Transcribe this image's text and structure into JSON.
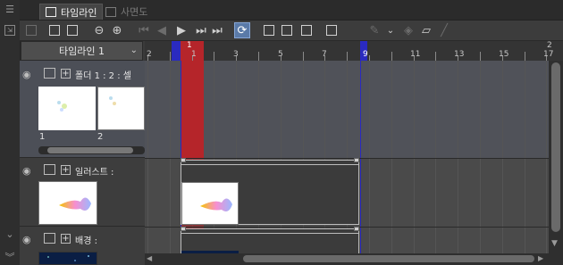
{
  "tabs": [
    {
      "label": "타임라인",
      "active": true
    },
    {
      "label": "사면도",
      "active": false
    }
  ],
  "timeline_select": {
    "value": "타임라인 1"
  },
  "ruler": {
    "numbers": [
      {
        "label": "2",
        "frame": 0
      },
      {
        "label": "1",
        "frame": 1
      },
      {
        "label": "3",
        "frame": 3
      },
      {
        "label": "5",
        "frame": 5
      },
      {
        "label": "7",
        "frame": 7
      },
      {
        "label": "9",
        "frame": 9
      },
      {
        "label": "11",
        "frame": 11
      },
      {
        "label": "13",
        "frame": 13
      },
      {
        "label": "15",
        "frame": 15
      },
      {
        "label": "2",
        "frame": 18
      },
      {
        "label": "17",
        "frame": 18
      }
    ],
    "current_frame_label": "1",
    "end_frame_label": "9"
  },
  "layers": [
    {
      "name": "폴더 1 : 2 : 셀",
      "type": "folder",
      "cells": [
        {
          "label": "1"
        },
        {
          "label": "2"
        }
      ]
    },
    {
      "name": "일러스트 :",
      "type": "image"
    },
    {
      "name": "배경 :",
      "type": "image"
    }
  ],
  "colors": {
    "playhead": "#b5252a",
    "range_marker": "#2a2ac0",
    "active_tool": "#5a7aa8"
  },
  "toolbar_icons": [
    "layer-icon",
    "new-folder-timeline-icon",
    "timeline-settings-icon",
    "zoom-out-icon",
    "zoom-in-icon",
    "first-frame-icon",
    "prev-frame-icon",
    "play-icon",
    "next-frame-icon",
    "last-frame-icon",
    "loop-icon",
    "new-cell-icon",
    "new-animation-cell-icon",
    "specify-cell-icon",
    "cell-copy-icon",
    "keyframe-icon",
    "dropdown-icon",
    "onion-skin-icon",
    "light-table-icon",
    "pen-icon"
  ]
}
